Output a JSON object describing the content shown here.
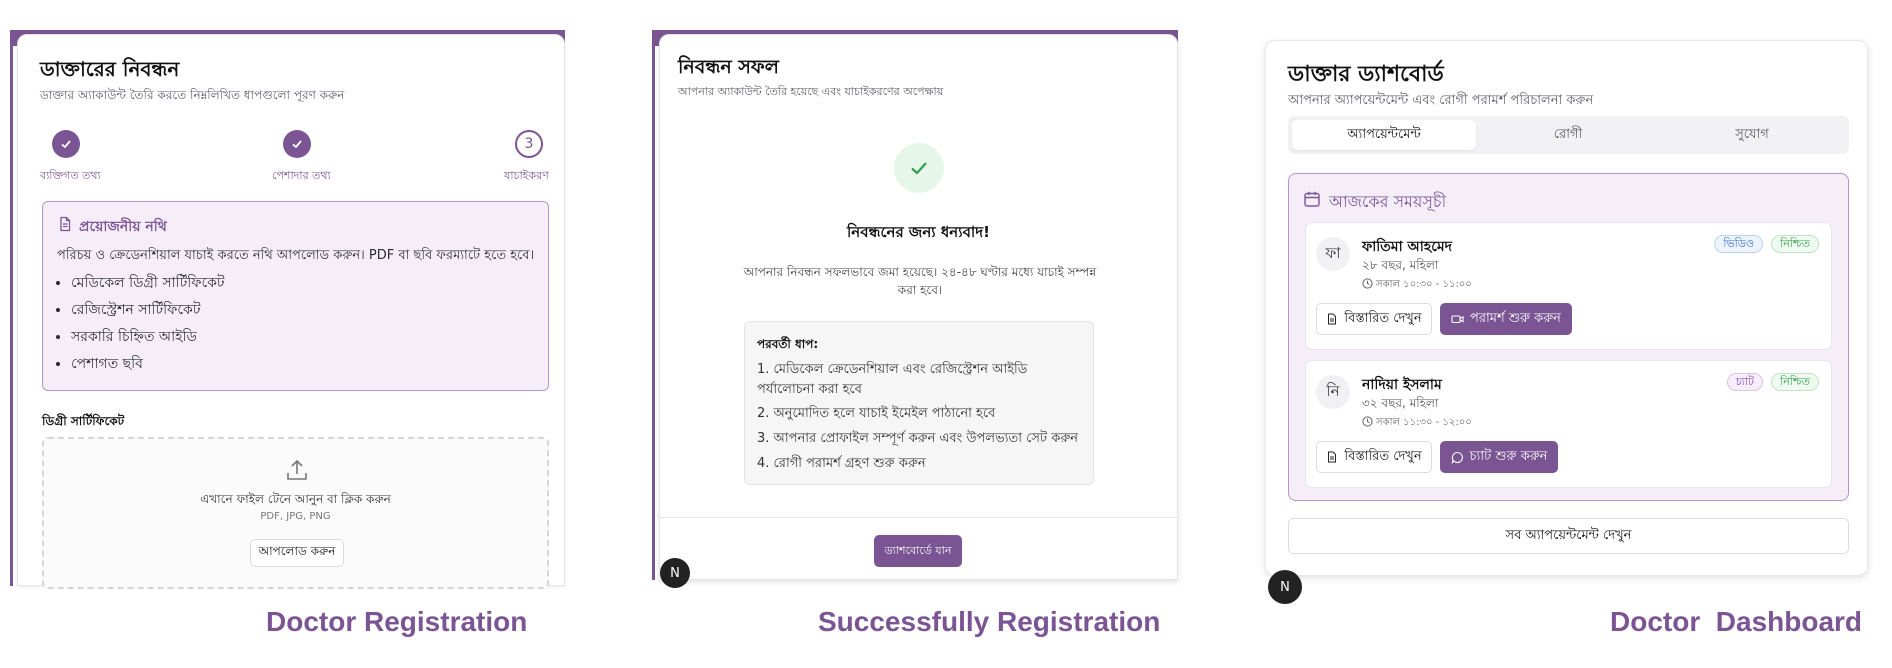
{
  "colors": {
    "accent": "#7b5494",
    "accent_light": "#f5eef8",
    "success": "#2e9c4a",
    "info": "#2f6fd6"
  },
  "registration": {
    "title": "ডাক্তারের নিবন্ধন",
    "subtitle": "ডাক্তার অ্যাকাউন্ট তৈরি করতে নিম্নলিখিত ধাপগুলো পূরণ করুন",
    "steps": [
      {
        "label": "ব্যক্তিগত তথ্য",
        "state": "done",
        "icon": "check-icon"
      },
      {
        "label": "পেশাদার তথ্য",
        "state": "done",
        "icon": "check-icon"
      },
      {
        "label": "যাচাইকরণ",
        "state": "current",
        "number": "3"
      }
    ],
    "docs": {
      "title": "প্রয়োজনীয় নথি",
      "description": "পরিচয় ও ক্রেডেনশিয়াল যাচাই করতে নথি আপলোড করুন। PDF বা ছবি ফরম্যাটে হতে হবে।",
      "items": [
        "মেডিকেল ডিগ্রী সার্টিফিকেট",
        "রেজিস্ট্রেশন সার্টিফিকেট",
        "সরকারি চিহ্নিত আইডি",
        "পেশাগত ছবি"
      ]
    },
    "upload": {
      "label": "ডিগ্রী সার্টিফিকেট",
      "hint": "এখানে ফাইল টেনে আনুন বা ক্লিক করুন",
      "formats": "PDF, JPG, PNG",
      "button": "আপলোড করুন"
    },
    "caption": "Doctor Registration"
  },
  "success": {
    "title": "নিবন্ধন সফল",
    "subtitle": "আপনার অ্যাকাউন্ট তৈরি হয়েছে এবং যাচাইকরণের অপেক্ষায়",
    "thanks": "নিবন্ধনের জন্য ধন্যবাদ!",
    "message": "আপনার নিবন্ধন সফলভাবে জমা হয়েছে। ২৪-৪৮ ঘণ্টার মধ্যে যাচাই সম্পন্ন করা হবে।",
    "next_title": "পরবর্তী ধাপ:",
    "next_steps": [
      "1. মেডিকেল ক্রেডেনশিয়াল এবং রেজিস্ট্রেশন আইডি পর্যালোচনা করা হবে",
      "2. অনুমোদিত হলে যাচাই ইমেইল পাঠানো হবে",
      "3. আপনার প্রোফাইল সম্পূর্ণ করুন এবং উপলভ্যতা সেট করুন",
      "4. রোগী পরামর্শ গ্রহণ শুরু করুন"
    ],
    "button": "ড্যাশবোর্ডে যান",
    "caption": "Successfully Registration"
  },
  "dashboard": {
    "title": "ডাক্তার ড্যাশবোর্ড",
    "subtitle": "আপনার অ্যাপয়েন্টমেন্ট এবং রোগী পরামর্শ পরিচালনা করুন",
    "tabs": [
      "অ্যাপয়েন্টমেন্ট",
      "রোগী",
      "সুযোগ"
    ],
    "schedule_title": "আজকের সময়সূচী",
    "appointments": [
      {
        "initial": "ফা",
        "name": "ফাতিমা আহমেদ",
        "meta": "২৮ বছর, মহিলা",
        "time": "সকাল ১০:৩০ - ১১:০০",
        "type_badge": "ভিডিও",
        "status_badge": "নিশ্চিত",
        "details_button": "বিস্তারিত দেখুন",
        "action_button": "পরামর্শ শুরু করুন",
        "action_icon": "video-icon"
      },
      {
        "initial": "নি",
        "name": "নাদিয়া ইসলাম",
        "meta": "৩২ বছর, মহিলা",
        "time": "সকাল ১১:৩০ - ১২:০০",
        "type_badge": "চ্যাট",
        "status_badge": "নিশ্চিত",
        "details_button": "বিস্তারিত দেখুন",
        "action_button": "চ্যাট শুরু করুন",
        "action_icon": "chat-icon"
      }
    ],
    "view_all": "সব অ্যাপয়েন্টমেন্ট দেখুন",
    "caption": "Doctor  Dashboard"
  },
  "dev_badge": "N"
}
